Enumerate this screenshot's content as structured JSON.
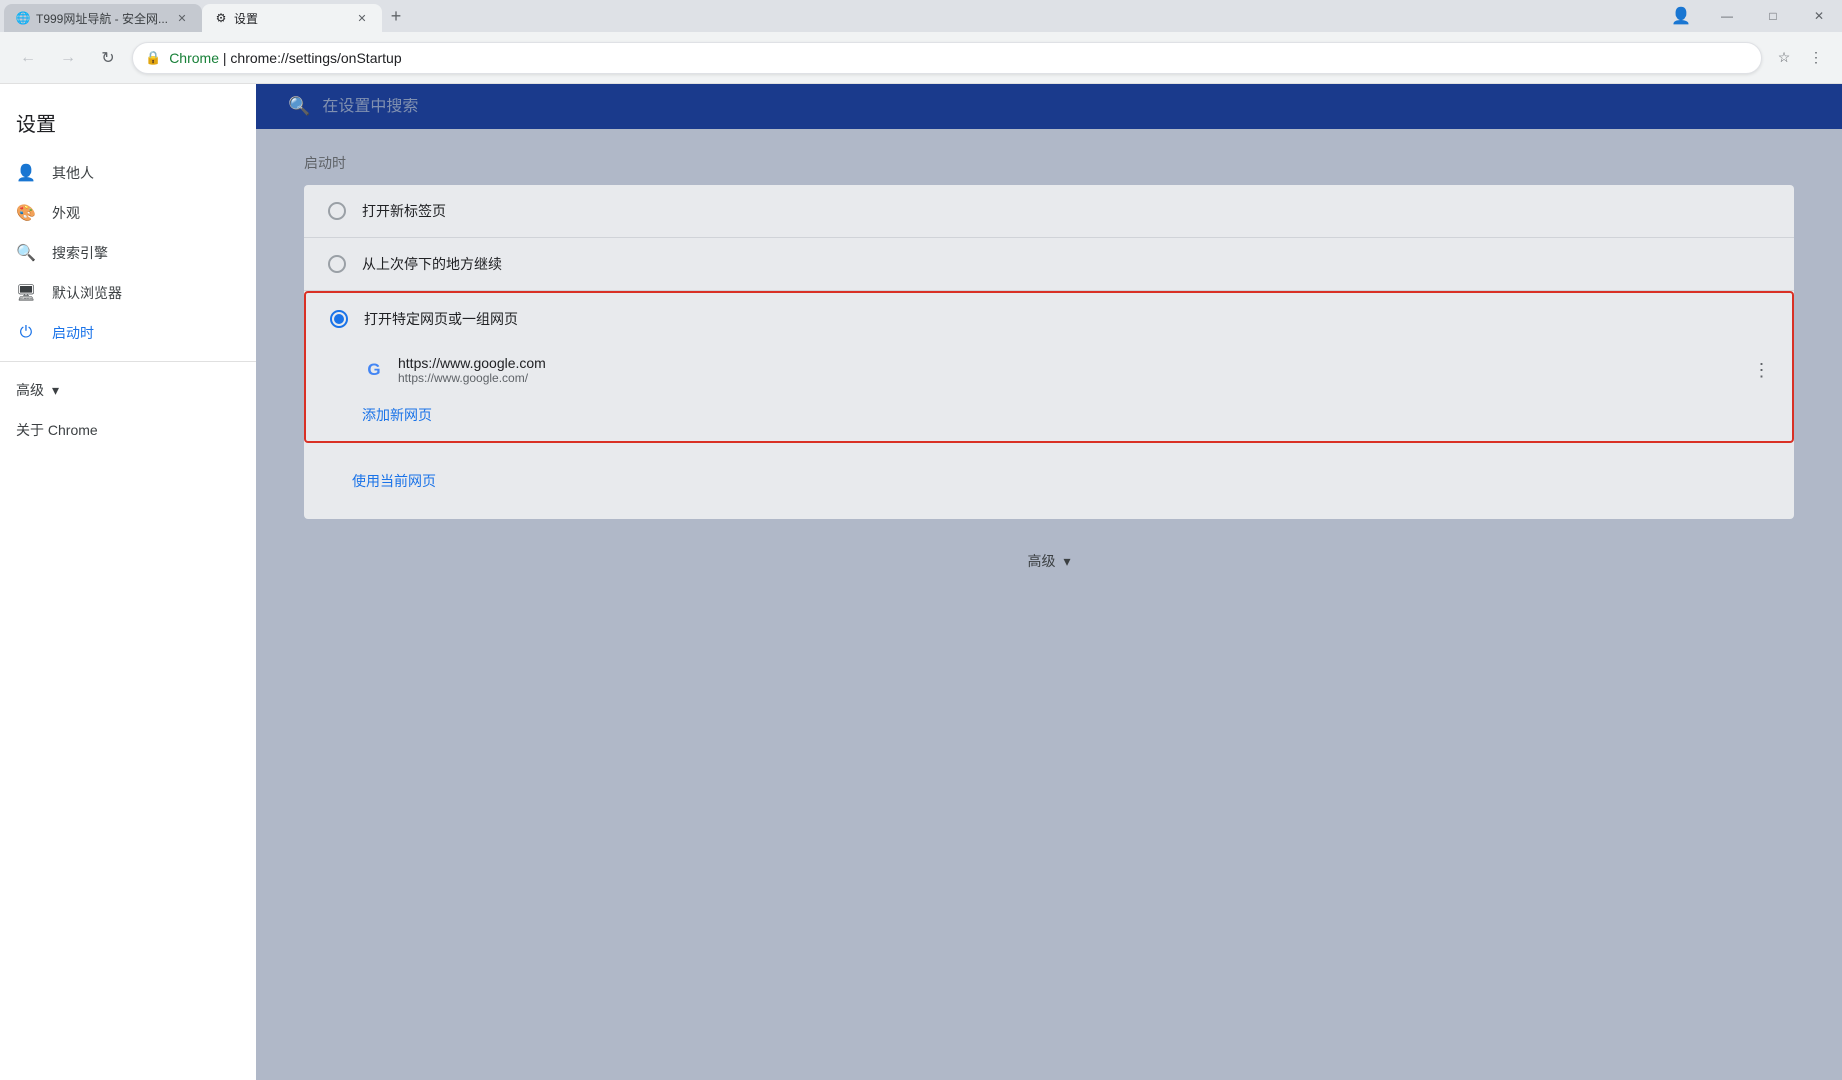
{
  "titlebar": {
    "tab1": {
      "favicon": "🌐",
      "title": "T999网址导航 - 安全网...",
      "active": false
    },
    "tab2": {
      "favicon": "⚙",
      "title": "设置",
      "active": true
    },
    "controls": {
      "minimize": "—",
      "maximize": "□",
      "close": "✕"
    }
  },
  "addressbar": {
    "back_title": "后退",
    "forward_title": "前进",
    "refresh_title": "刷新",
    "protocol": "Chrome",
    "separator": "|",
    "url": "chrome://settings/onStartup",
    "bookmark_title": "收藏",
    "menu_title": "菜单"
  },
  "sidebar": {
    "title": "设置",
    "items": [
      {
        "icon": "👤",
        "label": "其他人",
        "active": false
      },
      {
        "icon": "🎨",
        "label": "外观",
        "active": false
      },
      {
        "icon": "🔍",
        "label": "搜索引擎",
        "active": false
      },
      {
        "icon": "🖥",
        "label": "默认浏览器",
        "active": false
      },
      {
        "icon": "⏻",
        "label": "启动时",
        "active": true
      }
    ],
    "advanced_label": "高级",
    "about_label": "关于 Chrome"
  },
  "search": {
    "placeholder": "在设置中搜索"
  },
  "startup": {
    "section_title": "启动时",
    "option1": {
      "label": "打开新标签页",
      "selected": false
    },
    "option2": {
      "label": "从上次停下的地方继续",
      "selected": false
    },
    "option3": {
      "label": "打开特定网页或一组网页",
      "selected": true
    },
    "google_entry": {
      "name": "https://www.google.com",
      "url": "https://www.google.com/"
    },
    "add_link": "添加新网页",
    "use_current": "使用当前网页"
  },
  "advanced": {
    "label": "高级"
  }
}
